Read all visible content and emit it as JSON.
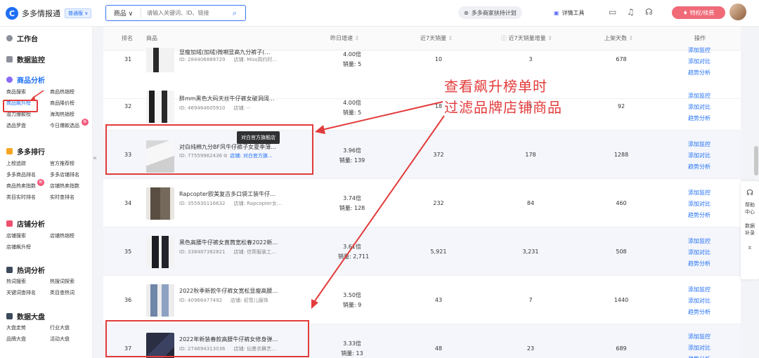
{
  "header": {
    "logo_text": "多多情报通",
    "edition": "普通版 ∨",
    "search": {
      "type": "商品",
      "placeholder": "请输入关键词、ID、链接"
    },
    "plan_label": "多多商家扶持计划",
    "tool_label": "详情工具",
    "vip_label": "特权/续费"
  },
  "sidebar": {
    "sections": [
      {
        "title": "工作台",
        "items": []
      },
      {
        "title": "数据监控",
        "items": []
      },
      {
        "title": "商品分析",
        "items": [
          "商品搜索",
          "商品热销榜",
          "商品飙升榜",
          "商品降价榜",
          "潜力爆款榜",
          "海淘热销榜",
          "选品罗盘",
          "今日爆款选品"
        ]
      },
      {
        "title": "多多排行",
        "items": [
          "上榜追踪",
          "官方推荐榜",
          "多多商品排名",
          "多多店铺排名",
          "商品热卖指数",
          "店铺热卖指数",
          "类目实时排名",
          "实时查排名"
        ]
      },
      {
        "title": "店铺分析",
        "items": [
          "店铺搜索",
          "店铺热销榜",
          "店铺飙升榜"
        ]
      },
      {
        "title": "热词分析",
        "items": [
          "热词搜索",
          "热搜词探索",
          "关键词查排名",
          "类目查热词"
        ]
      },
      {
        "title": "数据大盘",
        "items": [
          "大盘走势",
          "行业大盘",
          "品牌大盘",
          "活动大盘"
        ]
      }
    ],
    "hot_badge": "新"
  },
  "table": {
    "columns": [
      "排名",
      "商品",
      "昨日增速",
      "近7天销量",
      "近7天销量增量",
      "上架天数",
      "操作"
    ],
    "store_prefix": "店铺:",
    "sales_prefix": "销量:",
    "ops": [
      "添加监控",
      "添加对比",
      "趋势分析"
    ],
    "rows": [
      {
        "rank": "31",
        "title": "显瘦加绒(加绒)微喇显高九分裤子(…",
        "id": "ID:  284406889729",
        "store": "Miss简约时…",
        "growth": "4.00倍",
        "sales": "5",
        "week_sales": "10",
        "week_inc": "3",
        "days": "678"
      },
      {
        "rank": "32",
        "title": "胖mm黑色大码天丝牛仔裤女破洞阔…",
        "id": "ID:  469464605910",
        "store": "--",
        "growth": "4.00倍",
        "sales": "5",
        "week_sales": "18",
        "week_inc": "5",
        "days": "92"
      },
      {
        "rank": "33",
        "title": "对白纯棉九分BF风牛仔裤子女夏季薄…",
        "id": "ID:  77559962436",
        "store": "对白官方旗…",
        "growth": "3.96倍",
        "sales": "139",
        "week_sales": "372",
        "week_inc": "178",
        "days": "1288"
      },
      {
        "rank": "34",
        "title": "Rapcopter欧美复古多口袋工装牛仔…",
        "id": "ID:  355930116632",
        "store": "Rapcopter女…",
        "growth": "3.74倍",
        "sales": "128",
        "week_sales": "232",
        "week_inc": "84",
        "days": "460"
      },
      {
        "rank": "35",
        "title": "黑色高腰牛仔裤女直筒宽松春2022新…",
        "id": "ID:  338487382821",
        "store": "信帮服装工…",
        "growth": "3.61倍",
        "sales": "2,711",
        "week_sales": "5,921",
        "week_inc": "3,231",
        "days": "508"
      },
      {
        "rank": "36",
        "title": "2022秋季新款牛仔裤女宽松显瘦高腰…",
        "id": "ID:  40966477492",
        "store": "初雪儿服饰",
        "growth": "3.50倍",
        "sales": "9",
        "week_sales": "43",
        "week_inc": "7",
        "days": "1440"
      },
      {
        "rank": "37",
        "title": "2022年新装春款高腰牛仔裤女修身弹…",
        "id": "ID:  274694313036",
        "store": "仙曼衣舞艺…",
        "growth": "3.33倍",
        "sales": "13",
        "week_sales": "48",
        "week_inc": "23",
        "days": "689"
      }
    ]
  },
  "tooltip": "对白官方旗舰店",
  "annotation": {
    "line1": "查看飙升榜单时",
    "line2": "过滤品牌店铺商品"
  },
  "float_bar": {
    "help": "帮助中心",
    "data": "数据补录"
  },
  "colors": {
    "accent": "#1f6ff6",
    "annotation": "#e23b3b",
    "vip": "#f06a78"
  }
}
